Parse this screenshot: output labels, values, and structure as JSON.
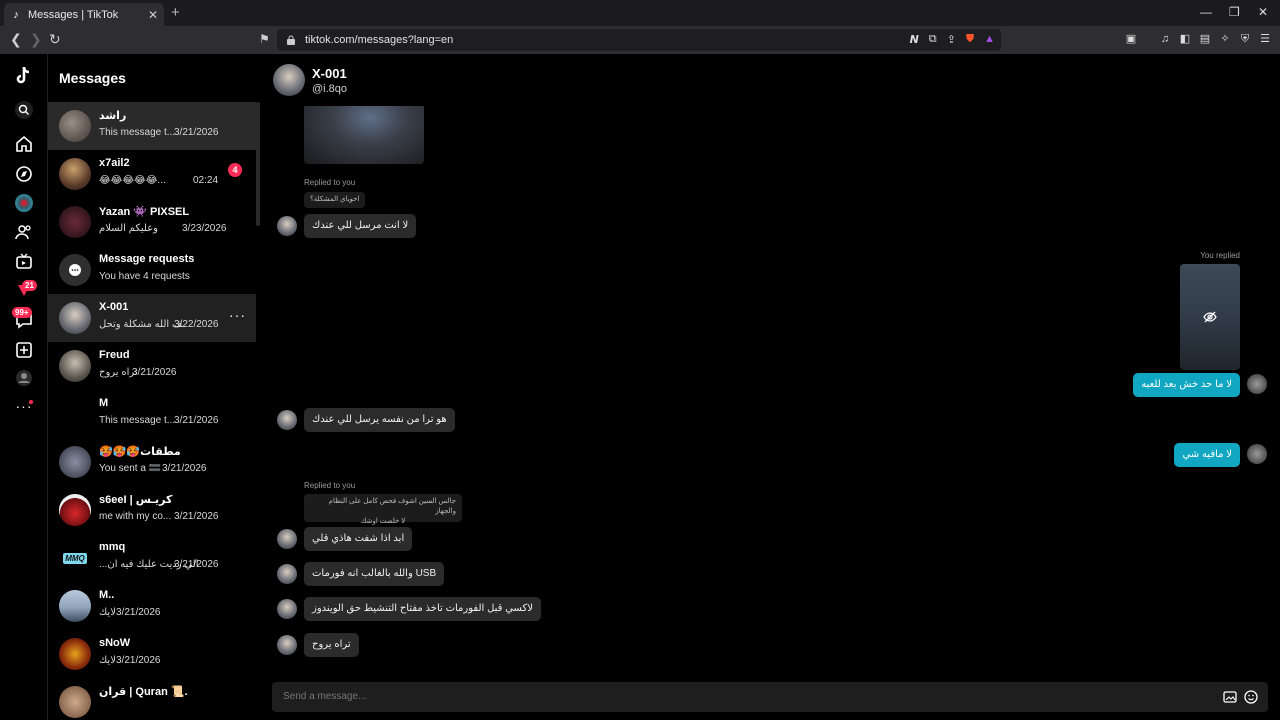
{
  "browser": {
    "tab_title": "Messages | TikTok",
    "tab_close": "✕",
    "new_tab": "+",
    "url": "tiktok.com/messages?lang=en",
    "window_controls": [
      "—",
      "❐",
      "✕"
    ]
  },
  "sidebar": {
    "title": "Messages",
    "notification_badge": "21",
    "messages_badge": "99+",
    "icons": [
      "tiktok-logo-icon",
      "search-icon",
      "home-icon",
      "explore-icon",
      "live-avatar-icon",
      "following-icon",
      "live-icon",
      "activity-icon",
      "messages-icon",
      "upload-icon",
      "profile-icon",
      "more-icon"
    ]
  },
  "conversations": [
    {
      "name": "راشد",
      "preview": "This message t...",
      "date": "3/21/2026",
      "state": "active"
    },
    {
      "name": "x7ail2",
      "preview": "😂😂😂😂😂...",
      "date": "02:24",
      "unread": "4"
    },
    {
      "name": "Yazan 👾 PIXSEL",
      "preview": "وعليكم السلام",
      "date": "3/23/2026"
    },
    {
      "name": "Message requests",
      "preview": "You have 4 requests",
      "date": ""
    },
    {
      "name": "X-001",
      "preview": "ـف الله مشكلة وتحل",
      "date": "3/22/2026",
      "state": "hover"
    },
    {
      "name": "Freud",
      "preview": "تراه يروح",
      "date": "3/21/2026"
    },
    {
      "name": "M",
      "preview": "This message t...",
      "date": "3/21/2026"
    },
    {
      "name": "🥵🥵🥵مطقات",
      "preview": "You sent a 🟰",
      "date": "3/21/2026"
    },
    {
      "name": "s6eeI | كريـس",
      "preview": "me with my co...",
      "date": "3/21/2026"
    },
    {
      "name": "mmq",
      "preview": "...الي رديت عليك فيه ان",
      "date": "3/21/2026"
    },
    {
      "name": "M..",
      "preview": "لايك",
      "date": "3/21/2026"
    },
    {
      "name": "sNoW",
      "preview": "لايك",
      "date": "3/21/2026"
    },
    {
      "name": "قران | Quran 📜.",
      "preview": "",
      "date": ""
    }
  ],
  "chat": {
    "name": "X-001",
    "handle": "@i.8qo",
    "replied_to_you": "Replied to you",
    "you_replied": "You replied",
    "messages": [
      {
        "quote": "اخوياي المشكلة؟",
        "text": "لا انت مرسل للي عندك"
      },
      {
        "text": "لا ما حد خش بعد للعبه",
        "side": "me"
      },
      {
        "text": "هو ترا من نفسه يرسل للي عندك"
      },
      {
        "text": "لا مافيه شي",
        "side": "me"
      },
      {
        "quote_line1": "جالس السين اشوف فحص كامل على النظام والجهاز",
        "quote_line2": "لا خلصت اوشك",
        "text": "ابد اذا شفت هاذي قلي"
      },
      {
        "text": "والله بالغالب انه فورمات USB"
      },
      {
        "text": "لاكسي قبل الفورمات تاخذ مفتاح التنشيط حق الويندوز"
      },
      {
        "text": "تراه يروح"
      }
    ],
    "composer_placeholder": "Send a message..."
  },
  "colors": {
    "accent": "#fe2c55",
    "my_bubble": "#11a7c2",
    "their_bubble": "#2b2b2b"
  }
}
